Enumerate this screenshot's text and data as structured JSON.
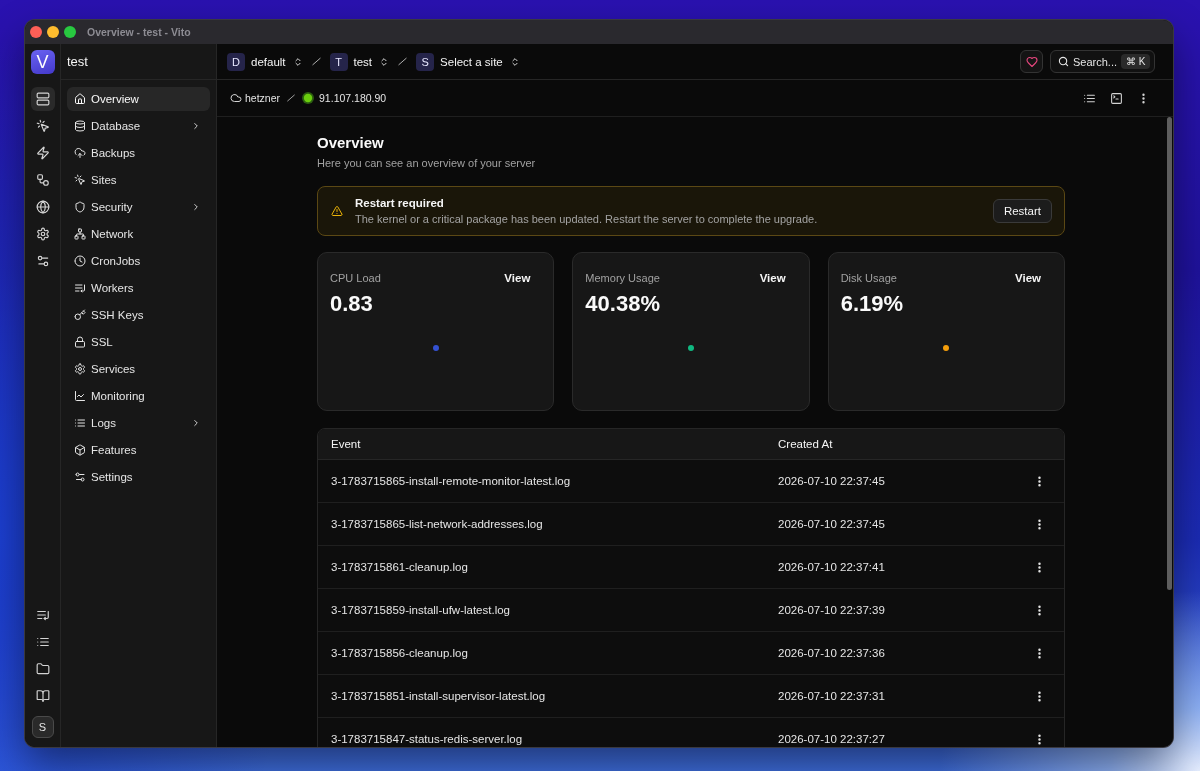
{
  "window": {
    "title": "Overview - test - Vito"
  },
  "rail": {
    "logo": "V",
    "items": [
      {
        "selected": true
      },
      {
        "selected": false
      },
      {
        "selected": false
      },
      {
        "selected": false
      },
      {
        "selected": false
      },
      {
        "selected": false
      },
      {
        "selected": false
      }
    ],
    "user_initial": "S"
  },
  "sidebar": {
    "project": "test",
    "items": [
      {
        "label": "Overview",
        "selected": true,
        "submenu": false
      },
      {
        "label": "Database",
        "selected": false,
        "submenu": true
      },
      {
        "label": "Backups",
        "selected": false,
        "submenu": false
      },
      {
        "label": "Sites",
        "selected": false,
        "submenu": false
      },
      {
        "label": "Security",
        "selected": false,
        "submenu": true
      },
      {
        "label": "Network",
        "selected": false,
        "submenu": false
      },
      {
        "label": "CronJobs",
        "selected": false,
        "submenu": false
      },
      {
        "label": "Workers",
        "selected": false,
        "submenu": false
      },
      {
        "label": "SSH Keys",
        "selected": false,
        "submenu": false
      },
      {
        "label": "SSL",
        "selected": false,
        "submenu": false
      },
      {
        "label": "Services",
        "selected": false,
        "submenu": false
      },
      {
        "label": "Monitoring",
        "selected": false,
        "submenu": false
      },
      {
        "label": "Logs",
        "selected": false,
        "submenu": true
      },
      {
        "label": "Features",
        "selected": false,
        "submenu": false
      },
      {
        "label": "Settings",
        "selected": false,
        "submenu": false
      }
    ]
  },
  "topbar": {
    "breadcrumbs": [
      {
        "badge": "D",
        "label": "default"
      },
      {
        "badge": "T",
        "label": "test"
      },
      {
        "badge": "S",
        "label": "Select a site"
      }
    ],
    "search": {
      "label": "Search...",
      "shortcut": "⌘ K"
    }
  },
  "server_bar": {
    "provider": "hetzner",
    "address": "91.107.180.90",
    "online": true
  },
  "page": {
    "title": "Overview",
    "subtitle": "Here you can see an overview of your server"
  },
  "alert": {
    "title": "Restart required",
    "message": "The kernel or a critical package has been updated. Restart the server to complete the upgrade.",
    "button": "Restart"
  },
  "metrics": [
    {
      "label": "CPU Load",
      "value": "0.83",
      "action": "View",
      "color": "#3451d1"
    },
    {
      "label": "Memory Usage",
      "value": "40.38%",
      "action": "View",
      "color": "#10b981"
    },
    {
      "label": "Disk Usage",
      "value": "6.19%",
      "action": "View",
      "color": "#f59e0b"
    }
  ],
  "table": {
    "columns": [
      "Event",
      "Created At"
    ],
    "rows": [
      {
        "event": "3-1783715865-install-remote-monitor-latest.log",
        "created_at": "2026-07-10 22:37:45"
      },
      {
        "event": "3-1783715865-list-network-addresses.log",
        "created_at": "2026-07-10 22:37:45"
      },
      {
        "event": "3-1783715861-cleanup.log",
        "created_at": "2026-07-10 22:37:41"
      },
      {
        "event": "3-1783715859-install-ufw-latest.log",
        "created_at": "2026-07-10 22:37:39"
      },
      {
        "event": "3-1783715856-cleanup.log",
        "created_at": "2026-07-10 22:37:36"
      },
      {
        "event": "3-1783715851-install-supervisor-latest.log",
        "created_at": "2026-07-10 22:37:31"
      },
      {
        "event": "3-1783715847-status-redis-server.log",
        "created_at": "2026-07-10 22:37:27"
      }
    ]
  }
}
